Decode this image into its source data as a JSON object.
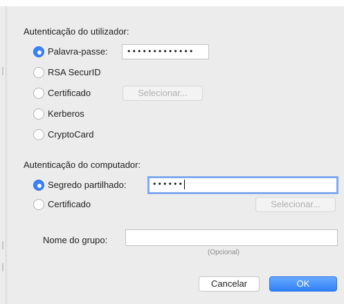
{
  "user_auth": {
    "heading": "Autenticação do utilizador:",
    "options": {
      "password": "Palavra-passe:",
      "rsa": "RSA SecurID",
      "certificate": "Certificado",
      "kerberos": "Kerberos",
      "cryptocard": "CryptoCard"
    },
    "selected": "password",
    "password_value": "•••••••••••••",
    "select_button": "Selecionar..."
  },
  "computer_auth": {
    "heading": "Autenticação do computador:",
    "options": {
      "shared_secret": "Segredo partilhado:",
      "certificate": "Certificado"
    },
    "selected": "shared_secret",
    "shared_secret_value": "••••••",
    "select_button": "Selecionar..."
  },
  "group": {
    "label": "Nome do grupo:",
    "value": "",
    "hint": "(Opcional)"
  },
  "actions": {
    "cancel": "Cancelar",
    "ok": "OK"
  },
  "colors": {
    "accent": "#3a82f6",
    "focus_ring": "#7faaf0",
    "panel_bg": "#ececec"
  }
}
